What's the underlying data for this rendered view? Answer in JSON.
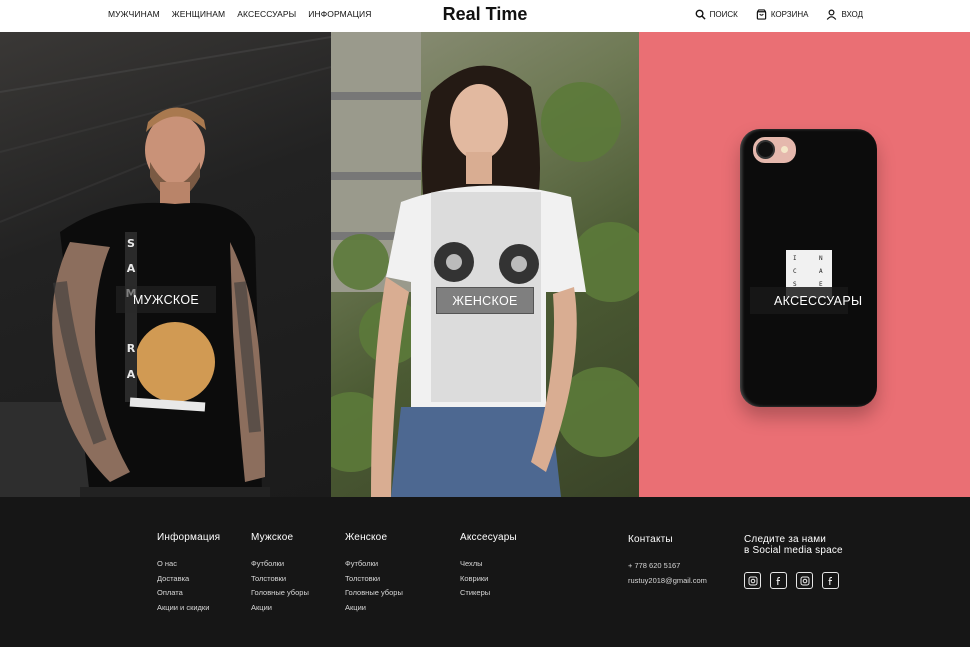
{
  "header": {
    "nav_left": [
      "МУЖЧИНАМ",
      "ЖЕНЩИНАМ",
      "АКСЕССУАРЫ",
      "ИНФОРМАЦИЯ"
    ],
    "logo": "Real Time",
    "search_label": "ПОИСК",
    "cart_label": "КОРЗИНА",
    "login_label": "ВХОД"
  },
  "hero": {
    "men_label": "МУЖСКОЕ",
    "women_label": "ЖЕНСКОЕ",
    "acc_label": "АКСЕССУАРЫ",
    "acc_bg_color": "#ea6f74",
    "tag_letters": [
      "I",
      "N",
      "C",
      "A",
      "S",
      "E"
    ]
  },
  "footer": {
    "info": {
      "title": "Информация",
      "items": [
        "О нас",
        "Доставка",
        "Оплата",
        "Акции и скидки"
      ]
    },
    "men": {
      "title": "Мужское",
      "items": [
        "Футболки",
        "Толстовки",
        "Головные уборы",
        "Акции"
      ]
    },
    "women": {
      "title": "Женское",
      "items": [
        "Футболки",
        "Толстовки",
        "Головные уборы",
        "Акции"
      ]
    },
    "accessories": {
      "title": "Акссесуары",
      "items": [
        "Чехлы",
        "Коврики",
        "Стикеры"
      ]
    },
    "contacts": {
      "title": "Контакты",
      "phone": "+ 778 620 5167",
      "email": "rustuy2018@gmail.com"
    },
    "social": {
      "title_line1": "Следите за нами",
      "title_line2": "в Social media space",
      "icons": [
        "instagram-icon",
        "facebook-icon",
        "instagram-icon",
        "facebook-icon"
      ]
    }
  }
}
